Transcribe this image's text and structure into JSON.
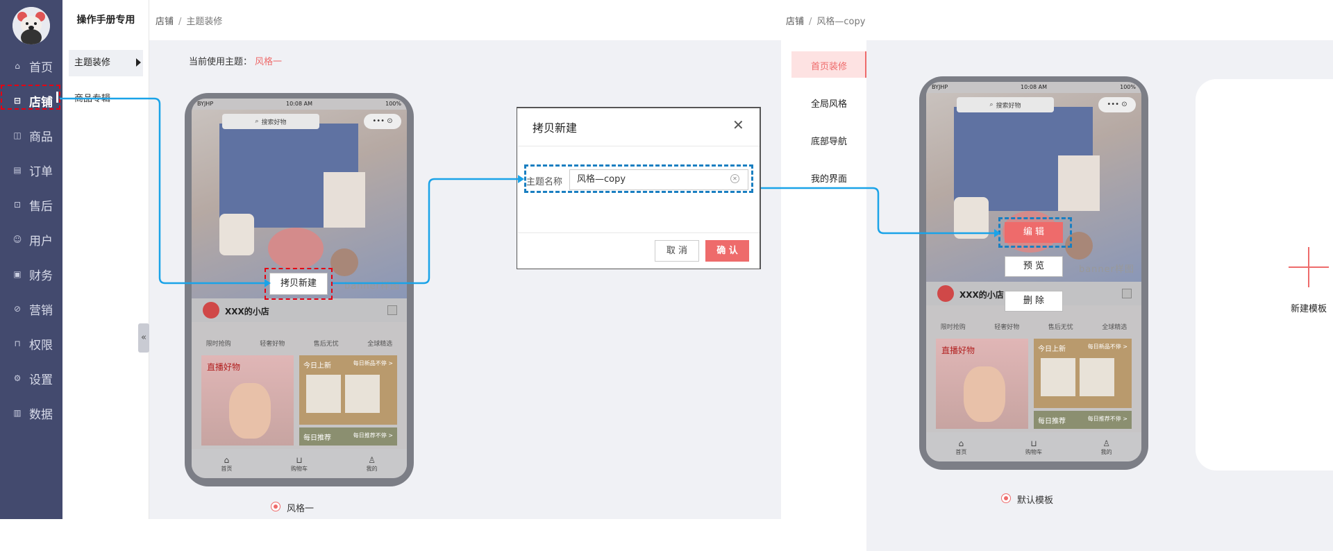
{
  "sidebar": {
    "items": [
      {
        "label": "首页",
        "icon": "home-icon"
      },
      {
        "label": "店铺",
        "icon": "store-icon"
      },
      {
        "label": "商品",
        "icon": "bag-icon"
      },
      {
        "label": "订单",
        "icon": "order-icon"
      },
      {
        "label": "售后",
        "icon": "aftersale-icon"
      },
      {
        "label": "用户",
        "icon": "user-icon"
      },
      {
        "label": "财务",
        "icon": "wallet-icon"
      },
      {
        "label": "营销",
        "icon": "marketing-icon"
      },
      {
        "label": "权限",
        "icon": "lock-icon"
      },
      {
        "label": "设置",
        "icon": "gear-icon"
      },
      {
        "label": "数据",
        "icon": "chart-icon"
      }
    ],
    "active_index": 1
  },
  "subnav": {
    "title": "操作手册专用",
    "items": [
      {
        "label": "主题装修"
      },
      {
        "label": "商品专辑"
      }
    ]
  },
  "left_panel": {
    "breadcrumb": {
      "root": "店铺",
      "separator": "/",
      "current": "主题装修"
    },
    "current_theme_label": "当前使用主题：",
    "current_theme_value": "风格一",
    "copy_button": "拷贝新建",
    "theme_radio_label": "风格一"
  },
  "phone": {
    "carrier": "BYJHP",
    "time": "10:08 AM",
    "battery": "100%",
    "search_placeholder": "搜索好物",
    "capsule": "••• ⊙",
    "banner_text": "banner样图",
    "shop_name": "XXX的小店",
    "tags": [
      "限时抢购",
      "轻奢好物",
      "售后无忧",
      "全球精选"
    ],
    "card_live": "直播好物",
    "card_new": "今日上新",
    "card_new_sub": "每日新品不停 >",
    "card_rec": "每日推荐",
    "card_rec_sub": "每日推荐不停 >",
    "tabbar": [
      {
        "label": "首页"
      },
      {
        "label": "购物车"
      },
      {
        "label": "我的"
      }
    ]
  },
  "dialog": {
    "title": "拷贝新建",
    "field_label": "主题名称",
    "field_value": "风格—copy",
    "cancel": "取 消",
    "confirm": "确 认"
  },
  "right_panel": {
    "breadcrumb": {
      "root": "店铺",
      "separator": "/",
      "current": "风格—copy"
    },
    "tabs": [
      {
        "label": "首页装修"
      },
      {
        "label": "全局风格"
      },
      {
        "label": "底部导航"
      },
      {
        "label": "我的界面"
      }
    ],
    "active_tab": 0,
    "edit_button": "编 辑",
    "preview_button": "预 览",
    "delete_button": "删 除",
    "template_radio_label": "默认模板",
    "new_template_label": "新建模板"
  },
  "colors": {
    "sidebar_bg": "#434a6e",
    "accent": "#ee6b6b",
    "highlight_red": "#e60012",
    "highlight_blue": "#1a7fc1",
    "arrow": "#1aa3e8"
  }
}
